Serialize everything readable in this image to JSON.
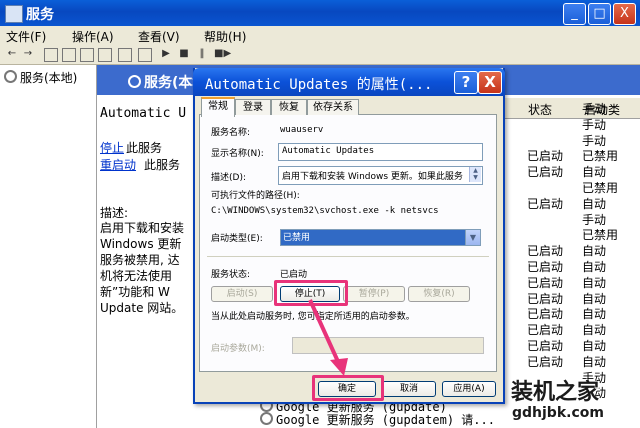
{
  "main_window": {
    "title": "服务",
    "menu": [
      "文件(F)",
      "操作(A)",
      "查看(V)",
      "帮助(H)"
    ],
    "caption_min": "_",
    "caption_max": "□",
    "caption_close": "X",
    "tree_node": "服务(本地)",
    "header_title": "服务(本地",
    "service_heading": "Automatic U",
    "stop_link": "停止",
    "stop_suffix": "此服务",
    "restart_link": "重启动",
    "restart_suffix": "此服务",
    "desc_label": "描述:",
    "desc_lines": [
      "启用下载和安装",
      "Windows 更新",
      "服务被禁用, 达",
      "机将无法使用",
      "新”功能和 W",
      "Update 网站。"
    ],
    "columns": {
      "status": "状态",
      "startup": "启动类"
    },
    "rows": [
      {
        "status": "",
        "startup": "手动"
      },
      {
        "status": "",
        "startup": "手动"
      },
      {
        "status": "",
        "startup": "手动"
      },
      {
        "status": "已启动",
        "startup": "已禁用"
      },
      {
        "status": "已启动",
        "startup": "自动"
      },
      {
        "status": "",
        "startup": "已禁用"
      },
      {
        "status": "已启动",
        "startup": "自动"
      },
      {
        "status": "",
        "startup": "手动"
      },
      {
        "status": "",
        "startup": "已禁用"
      },
      {
        "status": "已启动",
        "startup": "自动"
      },
      {
        "status": "已启动",
        "startup": "自动"
      },
      {
        "status": "已启动",
        "startup": "自动"
      },
      {
        "status": "已启动",
        "startup": "自动"
      },
      {
        "status": "已启动",
        "startup": "自动"
      },
      {
        "status": "已启动",
        "startup": "自动"
      },
      {
        "status": "已启动",
        "startup": "自动"
      },
      {
        "status": "已启动",
        "startup": "自动"
      },
      {
        "status": "",
        "startup": "手动"
      },
      {
        "status": "",
        "startup": "手动"
      }
    ],
    "bottom_rows": [
      "Google 更新服务 (gupdate)",
      "Google 更新服务 (gupdatem) 请..."
    ]
  },
  "dialog": {
    "title": "Automatic Updates 的属性(...",
    "help": "?",
    "close": "X",
    "tabs": [
      "常规",
      "登录",
      "恢复",
      "依存关系"
    ],
    "service_name_label": "服务名称:",
    "service_name_value": "wuauserv",
    "display_name_label": "显示名称(N):",
    "display_name_value": "Automatic Updates",
    "description_label": "描述(D):",
    "description_value": "启用下载和安装 Windows 更新。如果此服务",
    "exe_path_label": "可执行文件的路径(H):",
    "exe_path_value": "C:\\WINDOWS\\system32\\svchost.exe -k netsvcs",
    "startup_type_label": "启动类型(E):",
    "startup_type_value": "已禁用",
    "status_label": "服务状态:",
    "status_value": "已启动",
    "buttons": {
      "start": "启动(S)",
      "stop": "停止(T)",
      "pause": "暂停(P)",
      "resume": "恢复(R)"
    },
    "hint": "当从此处启动服务时, 您可指定所适用的启动参数。",
    "param_label": "启动参数(M):",
    "ok": "确定",
    "cancel": "取消",
    "apply": "应用(A)"
  },
  "watermark": {
    "name": "装机之家",
    "url": "gdhjbk.com"
  },
  "colors": {
    "highlight": "#e8337a",
    "titlebar": "#0a55d0",
    "link": "#0033cc"
  },
  "icons": [
    "back-arrow-icon",
    "forward-arrow-icon",
    "play-icon",
    "stop-icon",
    "pause-icon",
    "restart-icon",
    "gear-icon"
  ]
}
